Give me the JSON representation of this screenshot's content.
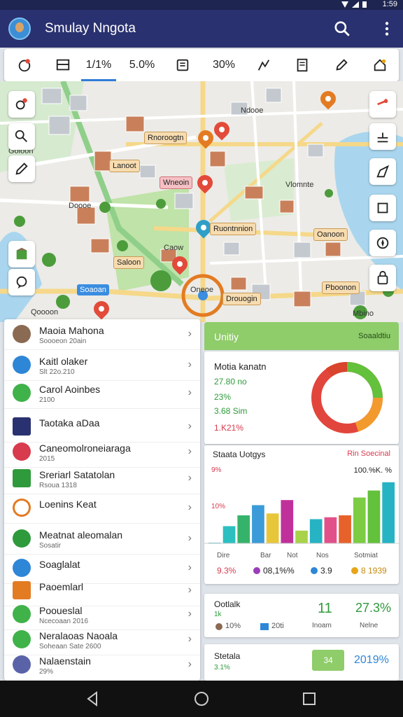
{
  "status": {
    "time": "1:59"
  },
  "appbar": {
    "title": "Smulay Nngota"
  },
  "toolbar": {
    "items": [
      "",
      "",
      "1/1%",
      "5.0%",
      "",
      "30%",
      "",
      "",
      "",
      ""
    ]
  },
  "map": {
    "labels": [
      "Rnoroogtn",
      "Lanoot",
      "Wneoin",
      "Ruontnnion",
      "Saloon",
      "Soaoan",
      "Oanoon",
      "Pboonon",
      "Drouogin",
      "Vlomnte",
      "Ndooe",
      "Doooe",
      "Goloon",
      "Qoooon",
      "Oneoe",
      "Mbino",
      "Caow"
    ],
    "accent": "#2f7cd8"
  },
  "list": {
    "items": [
      {
        "title": "Maoia Mahona",
        "sub": "Soooeon 20ain",
        "icon": "building-icon",
        "color": "#8a6a52"
      },
      {
        "title": "Kaitl olaker",
        "sub": "Slt 22o.210",
        "icon": "wifi-icon",
        "color": "#2e86d6"
      },
      {
        "title": "Carol Aoinbes",
        "sub": "2100",
        "icon": "list-icon",
        "color": "#3fb24a"
      },
      {
        "title": "Taotaka aDaa",
        "sub": "",
        "icon": "flag-icon",
        "color": "#2a3170"
      },
      {
        "title": "Caneomolroneiaraga",
        "sub": "2015",
        "icon": "card-icon",
        "color": "#d83a4e"
      },
      {
        "title": "Sreriarl Satatolan",
        "sub": "Rsoua 1318",
        "icon": "box-icon",
        "color": "#2f9a3c"
      },
      {
        "title": "Loenins Keat",
        "sub": "",
        "icon": "ring-icon",
        "color": "#e37b22"
      },
      {
        "title": "Meatnat aleomalan",
        "sub": "Sosatir",
        "icon": "lines-icon",
        "color": "#2f9a3c"
      },
      {
        "title": "Soaglalat",
        "sub": "",
        "icon": "compass-icon",
        "color": "#2e86d6"
      },
      {
        "title": "Paoemlarl",
        "sub": "",
        "icon": "doc-icon",
        "color": "#e37b22"
      },
      {
        "title": "Pooueslal",
        "sub": "Ncecoaan 2016",
        "icon": "dollar-icon",
        "color": "#3fb24a"
      },
      {
        "title": "Neralaoas Naoala",
        "sub": "Soheaan Sate 2600",
        "icon": "check-icon",
        "color": "#3fb24a"
      },
      {
        "title": "Nalaenstain",
        "sub": "29%",
        "icon": "circle-icon",
        "color": "#5a63a8"
      }
    ]
  },
  "panel": {
    "header_left": "Unitiy",
    "header_right": "Soaaldtiu",
    "donut_card": {
      "title": "Motia kanatn",
      "v1": "27.80 no",
      "v2": "23%",
      "v3": "3.68 Sim",
      "v4": "1.K21%"
    },
    "bar_card": {
      "title": "Staata Uotgys",
      "subtitle": "Rin Soecinal",
      "legend_left": "9%",
      "legend_right": "100.%K. %",
      "tick": "10%",
      "months": [
        "Dire",
        "Bar",
        "Not",
        "Nos",
        "Sotmiat"
      ],
      "stats": [
        {
          "label": "9.3%",
          "color": "#d83a4e"
        },
        {
          "label": "08,1%%",
          "color": "#9a3dba"
        },
        {
          "label": "3.9",
          "color": "#2e86d6"
        },
        {
          "label": "8 1939",
          "color": "#e8a41a"
        }
      ]
    },
    "stat_card": {
      "title": "Ootlalk",
      "sub": "1k",
      "v1": "10%",
      "v2": "20ti",
      "big1": "11",
      "big1_label": "Inoam",
      "big2": "27.3%",
      "big2_label": "Nelne"
    },
    "bottom_card": {
      "title": "Stetala",
      "sub": "3.1%",
      "badge": "34",
      "value": "2019%"
    }
  },
  "chart_data": {
    "type": "bar",
    "categories": [
      "Dire",
      "",
      "Bar",
      "",
      "Not",
      "",
      "Nos",
      "",
      "",
      "Sotmiat",
      "",
      ""
    ],
    "values": [
      1,
      27,
      44,
      60,
      47,
      68,
      20,
      38,
      41,
      44,
      72,
      83,
      96
    ],
    "colors": [
      "#26b3c4",
      "#2bbfbf",
      "#36b36a",
      "#3a9bd8",
      "#e8c63a",
      "#c0309a",
      "#a8d24a",
      "#26b3c4",
      "#e2508a",
      "#e7612b",
      "#7ccc44",
      "#63c13c"
    ],
    "ylim": [
      0,
      110
    ]
  }
}
